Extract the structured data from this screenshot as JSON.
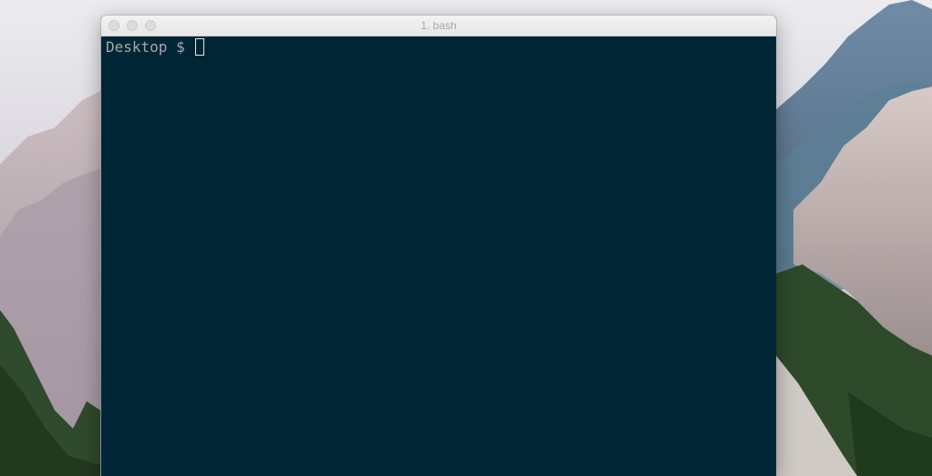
{
  "window": {
    "title": "1. bash"
  },
  "terminal": {
    "prompt": "Desktop $ "
  },
  "colors": {
    "terminal_background": "#002635",
    "prompt_text": "#a6a8a9",
    "titlebar": "#ececec"
  },
  "icons": {
    "close": "close-icon",
    "minimize": "minimize-icon",
    "zoom": "zoom-icon"
  }
}
